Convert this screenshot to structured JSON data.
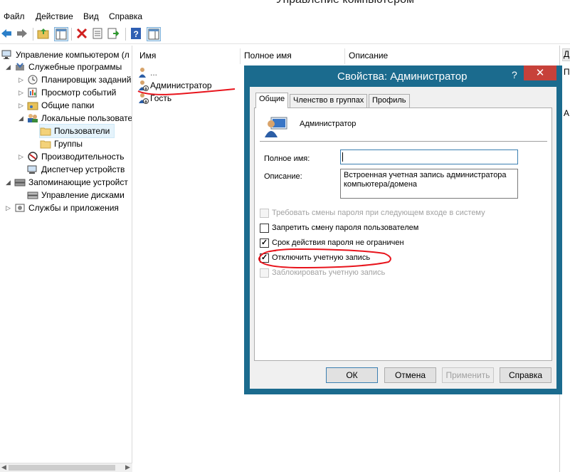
{
  "window": {
    "title": "Управление компьютером"
  },
  "menu": [
    "Файл",
    "Действие",
    "Вид",
    "Справка"
  ],
  "toolbar": {
    "icons": [
      "back-arrow-icon",
      "forward-arrow-icon",
      "up-folder-icon",
      "show-hide-tree-icon",
      "delete-icon",
      "properties-icon",
      "export-list-icon",
      "help-icon",
      "show-hide-action-pane-icon"
    ]
  },
  "tree": {
    "root": "Управление компьютером (л",
    "system_tools": "Служебные программы",
    "task_scheduler": "Планировщик заданий",
    "event_viewer": "Просмотр событий",
    "shared_folders": "Общие папки",
    "local_users": "Локальные пользовате",
    "users": "Пользователи",
    "groups": "Группы",
    "performance": "Производительность",
    "device_manager": "Диспетчер устройств",
    "storage": "Запоминающие устройст",
    "disk_management": "Управление дисками",
    "services_apps": "Службы и приложения"
  },
  "list": {
    "columns": [
      "Имя",
      "Полное имя",
      "Описание"
    ],
    "rows": [
      {
        "name": "..."
      },
      {
        "name": "Администратор"
      },
      {
        "name": "Гость"
      }
    ]
  },
  "actions": {
    "header": "Д",
    "link": "П",
    "link2": "А"
  },
  "dialog": {
    "title": "Свойства: Администратор",
    "help_button": "?",
    "close_button": "✕",
    "tabs": [
      "Общие",
      "Членство в группах",
      "Профиль"
    ],
    "account_name": "Администратор",
    "full_name_label": "Полное имя:",
    "full_name_value": "",
    "description_label": "Описание:",
    "description_value": "Встроенная учетная запись администратора компьютера/домена",
    "checkboxes": [
      {
        "label": "Требовать смены пароля при следующем входе в систему",
        "checked": false,
        "enabled": false
      },
      {
        "label": "Запретить смену пароля пользователем",
        "checked": false,
        "enabled": true
      },
      {
        "label": "Срок действия пароля не ограничен",
        "checked": true,
        "enabled": true
      },
      {
        "label": "Отключить учетную запись",
        "checked": true,
        "enabled": true
      },
      {
        "label": "Заблокировать учетную запись",
        "checked": false,
        "enabled": false
      }
    ],
    "buttons": {
      "ok": "ОК",
      "cancel": "Отмена",
      "apply": "Применить",
      "help": "Справка"
    }
  },
  "colors": {
    "dialog_frame": "#1b6b8e",
    "close_button": "#c7413a",
    "annotation": "#e8141c",
    "selection": "#e5f3fb"
  }
}
